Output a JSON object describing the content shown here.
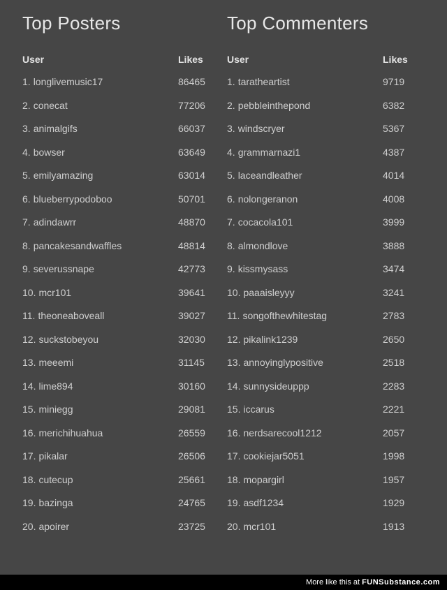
{
  "posters": {
    "title": "Top Posters",
    "header_user": "User",
    "header_likes": "Likes",
    "rows": [
      {
        "rank": "1.",
        "user": "longlivemusic17",
        "likes": "86465"
      },
      {
        "rank": "2.",
        "user": "conecat",
        "likes": "77206"
      },
      {
        "rank": "3.",
        "user": "animalgifs",
        "likes": "66037"
      },
      {
        "rank": "4.",
        "user": "bowser",
        "likes": "63649"
      },
      {
        "rank": "5.",
        "user": "emilyamazing",
        "likes": "63014"
      },
      {
        "rank": "6.",
        "user": "blueberrypodoboo",
        "likes": "50701"
      },
      {
        "rank": "7.",
        "user": "adindawrr",
        "likes": "48870"
      },
      {
        "rank": "8.",
        "user": "pancakesandwaffles",
        "likes": "48814"
      },
      {
        "rank": "9.",
        "user": "severussnape",
        "likes": "42773"
      },
      {
        "rank": "10.",
        "user": "mcr101",
        "likes": "39641"
      },
      {
        "rank": "11.",
        "user": "theoneaboveall",
        "likes": "39027"
      },
      {
        "rank": "12.",
        "user": "suckstobeyou",
        "likes": "32030"
      },
      {
        "rank": "13.",
        "user": "meeemi",
        "likes": "31145"
      },
      {
        "rank": "14.",
        "user": "lime894",
        "likes": "30160"
      },
      {
        "rank": "15.",
        "user": "miniegg",
        "likes": "29081"
      },
      {
        "rank": "16.",
        "user": "merichihuahua",
        "likes": "26559"
      },
      {
        "rank": "17.",
        "user": "pikalar",
        "likes": "26506"
      },
      {
        "rank": "18.",
        "user": "cutecup",
        "likes": "25661"
      },
      {
        "rank": "19.",
        "user": "bazinga",
        "likes": "24765"
      },
      {
        "rank": "20.",
        "user": "apoirer",
        "likes": "23725"
      }
    ]
  },
  "commenters": {
    "title": "Top Commenters",
    "header_user": "User",
    "header_likes": "Likes",
    "rows": [
      {
        "rank": "1.",
        "user": "taratheartist",
        "likes": "9719"
      },
      {
        "rank": "2.",
        "user": "pebbleinthepond",
        "likes": "6382"
      },
      {
        "rank": "3.",
        "user": "windscryer",
        "likes": "5367"
      },
      {
        "rank": "4.",
        "user": "grammarnazi1",
        "likes": "4387"
      },
      {
        "rank": "5.",
        "user": "laceandleather",
        "likes": "4014"
      },
      {
        "rank": "6.",
        "user": "nolongeranon",
        "likes": "4008"
      },
      {
        "rank": "7.",
        "user": "cocacola101",
        "likes": "3999"
      },
      {
        "rank": "8.",
        "user": "almondlove",
        "likes": "3888"
      },
      {
        "rank": "9.",
        "user": "kissmysass",
        "likes": "3474"
      },
      {
        "rank": "10.",
        "user": "paaaisleyyy",
        "likes": "3241"
      },
      {
        "rank": "11.",
        "user": "songofthewhitestag",
        "likes": "2783"
      },
      {
        "rank": "12.",
        "user": "pikalink1239",
        "likes": "2650"
      },
      {
        "rank": "13.",
        "user": "annoyinglypositive",
        "likes": "2518"
      },
      {
        "rank": "14.",
        "user": "sunnysideuppp",
        "likes": "2283"
      },
      {
        "rank": "15.",
        "user": "iccarus",
        "likes": "2221"
      },
      {
        "rank": "16.",
        "user": "nerdsarecool1212",
        "likes": "2057"
      },
      {
        "rank": "17.",
        "user": "cookiejar5051",
        "likes": "1998"
      },
      {
        "rank": "18.",
        "user": "mopargirl",
        "likes": "1957"
      },
      {
        "rank": "19.",
        "user": "asdf1234",
        "likes": "1929"
      },
      {
        "rank": "20.",
        "user": "mcr101",
        "likes": "1913"
      }
    ]
  },
  "footer": {
    "prefix": "More like this at",
    "brand_bold": "FUN",
    "brand_rest": "Substance",
    "tld": ".com"
  }
}
